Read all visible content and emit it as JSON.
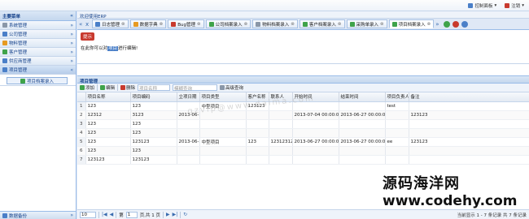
{
  "top": {
    "control_panel": "控制面板",
    "logout": "注销"
  },
  "left": {
    "title": "主要菜单",
    "modules": [
      {
        "label": "系统管理"
      },
      {
        "label": "公司管理"
      },
      {
        "label": "物料管理"
      },
      {
        "label": "客户管理"
      },
      {
        "label": "供应商管理"
      },
      {
        "label": "项目管理"
      }
    ],
    "sub_button": "项目档案录入",
    "footer": "数据备份"
  },
  "main": {
    "welcome": "欢迎使用ERP",
    "tabs": [
      {
        "label": "日志管理"
      },
      {
        "label": "数据字典"
      },
      {
        "label": "Bug管理"
      },
      {
        "label": "公司档案录入"
      },
      {
        "label": "物料档案录入"
      },
      {
        "label": "客户档案录入"
      },
      {
        "label": "采购单录入"
      },
      {
        "label": "项目档案录入"
      }
    ],
    "notice_tag": "提示",
    "notice_pre": "在此你可以对",
    "notice_hl": "项目",
    "notice_post": "进行编辑!",
    "grid_title": "项目管理",
    "toolbar": {
      "add": "添加",
      "edit": "编辑",
      "delete": "删除",
      "combo": "项目名称",
      "search_placeholder": "模糊查询",
      "advanced": "高级查询"
    },
    "columns": [
      "",
      "项目名称",
      "项目编码",
      "立项日期",
      "项目类型",
      "客户名称",
      "联系人",
      "开始时间",
      "结束时间",
      "项目负责人",
      "备注"
    ],
    "rows": [
      [
        "1",
        "123",
        "123",
        "",
        "中型项目",
        "123123",
        "",
        "",
        "",
        "test",
        ""
      ],
      [
        "2",
        "12312",
        "3123",
        "2013-06-2",
        "",
        "",
        "",
        "2013-07-04 00:00:0",
        "2013-06-27 00:00:0",
        "",
        "123123"
      ],
      [
        "3",
        "123",
        "123",
        "",
        "",
        "",
        "",
        "",
        "",
        "",
        ""
      ],
      [
        "4",
        "123",
        "123",
        "",
        "",
        "",
        "",
        "",
        "",
        "",
        ""
      ],
      [
        "5",
        "123",
        "123123",
        "2013-06-2",
        "中型项目",
        "123",
        "12312312",
        "2013-06-27 00:00:0",
        "2013-06-27 00:00:0",
        "ee",
        "123123"
      ],
      [
        "6",
        "123",
        "123",
        "",
        "",
        "",
        "",
        "",
        "",
        "",
        ""
      ],
      [
        "7",
        "123123",
        "123123",
        "",
        "",
        "",
        "",
        "",
        "",
        "",
        ""
      ]
    ],
    "pager": {
      "page_size": "10",
      "page_label_pre": "第",
      "page": "1",
      "page_label_post": "页,共 1 页",
      "info": "当前显示 1 - 7 条记录 共 7 条记录"
    }
  },
  "watermark": {
    "diag": "gzvip@www.daima.com",
    "cn": "源码海洋网",
    "url": "www.codehy.com"
  }
}
